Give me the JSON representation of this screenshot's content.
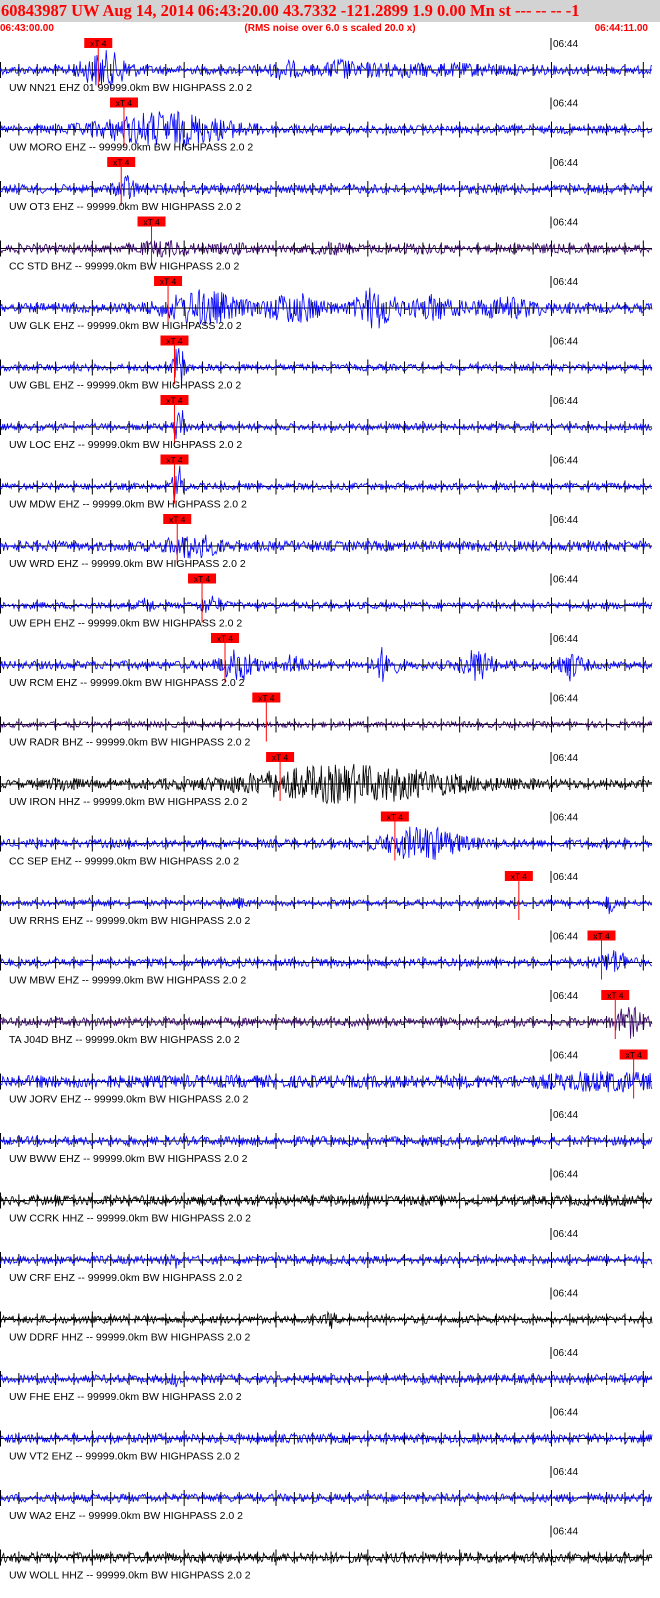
{
  "header": {
    "title": "60843987 UW Aug 14, 2014 06:43:20.00   43.7332 -121.2899  1.9 0.00 Mn st --- -- --  -1",
    "start_time": "06:43:00.00",
    "rms_note": "(RMS noise over 6.0 s scaled 20.0 x)",
    "end_time": "06:44:11.00"
  },
  "colors": {
    "title": "#ff0000",
    "header_bg": "#d3d3d3",
    "pick": "#ff0000",
    "axis": "#000000"
  },
  "chart_data": {
    "type": "line",
    "x_range_seconds": [
      0,
      71
    ],
    "minute_mark_seconds": 60,
    "minute_mark_label": "06:44",
    "pick_label": "xT 4",
    "tick_spacing_seconds": 2,
    "traces": [
      {
        "label": "UW NN21 EHZ 01 99999.0km BW  HIGHPASS  2.0  2",
        "color": "#0000ff",
        "pick_s": 10.7,
        "amp": 0.32,
        "bursts": [
          [
            11.5,
            2.5,
            4.5
          ],
          [
            31,
            1.5,
            2.5
          ],
          [
            37,
            1.2,
            2.5
          ],
          [
            42,
            6,
            1.8
          ],
          [
            52,
            6,
            1.5
          ]
        ]
      },
      {
        "label": "UW MORO EHZ -- 99999.0km BW  HIGHPASS  2.0  2",
        "color": "#0000ff",
        "pick_s": 13.5,
        "amp": 0.3,
        "bursts": [
          [
            18,
            7,
            4.5
          ]
        ]
      },
      {
        "label": "UW OT3 EHZ -- 99999.0km BW  HIGHPASS  2.0  2",
        "color": "#0000ff",
        "pick_s": 13.2,
        "amp": 0.32,
        "bursts": [
          [
            13.8,
            1,
            3.5
          ]
        ]
      },
      {
        "label": "CC STD BHZ -- 99999.0km BW  HIGHPASS  2.0  2",
        "color": "#330066",
        "pick_s": 16.5,
        "amp": 0.3,
        "bursts": [
          [
            18,
            3,
            2.2
          ],
          [
            26,
            2,
            1.6
          ],
          [
            36,
            2,
            1.8
          ],
          [
            45,
            3,
            1.4
          ],
          [
            58,
            3,
            1.3
          ]
        ]
      },
      {
        "label": "UW GLK EHZ -- 99999.0km BW  HIGHPASS  2.0  2",
        "color": "#0000ff",
        "pick_s": 18.3,
        "amp": 0.35,
        "bursts": [
          [
            22,
            4,
            4
          ],
          [
            32,
            3,
            3.5
          ],
          [
            41,
            2,
            5
          ],
          [
            47,
            2,
            3
          ],
          [
            55,
            4,
            2.5
          ]
        ]
      },
      {
        "label": "UW GBL EHZ -- 99999.0km BW  HIGHPASS  2.0  2",
        "color": "#0000ff",
        "pick_s": 19.0,
        "amp": 0.25,
        "bursts": [
          [
            19.5,
            0.6,
            7
          ]
        ]
      },
      {
        "label": "UW LOC EHZ -- 99999.0km BW  HIGHPASS  2.0  2",
        "color": "#0000ff",
        "pick_s": 19.0,
        "amp": 0.25,
        "bursts": [
          [
            19.6,
            0.6,
            7
          ]
        ]
      },
      {
        "label": "UW MDW EHZ -- 99999.0km BW  HIGHPASS  2.0  2",
        "color": "#0000ff",
        "pick_s": 19.0,
        "amp": 0.25,
        "bursts": [
          [
            19.4,
            0.6,
            7
          ]
        ]
      },
      {
        "label": "UW WRD EHZ -- 99999.0km BW  HIGHPASS  2.0  2",
        "color": "#0000ff",
        "pick_s": 19.3,
        "amp": 0.35,
        "bursts": [
          [
            21,
            2.5,
            3
          ]
        ]
      },
      {
        "label": "UW EPH EHZ -- 99999.0km BW  HIGHPASS  2.0  2",
        "color": "#0000ff",
        "pick_s": 22.0,
        "amp": 0.25,
        "bursts": [
          [
            23,
            1.2,
            3
          ],
          [
            16,
            0.8,
            2.5
          ]
        ]
      },
      {
        "label": "UW RCM EHZ -- 99999.0km BW  HIGHPASS  2.0  2",
        "color": "#0000ff",
        "pick_s": 24.5,
        "amp": 0.3,
        "bursts": [
          [
            26,
            2,
            4
          ],
          [
            32,
            1,
            3
          ],
          [
            42,
            1,
            5
          ],
          [
            52,
            1.5,
            4.5
          ],
          [
            62,
            1.2,
            4
          ]
        ]
      },
      {
        "label": "UW RADR BHZ -- 99999.0km BW  HIGHPASS  2.0  2",
        "color": "#330066",
        "pick_s": 29.0,
        "amp": 0.22,
        "bursts": []
      },
      {
        "label": "UW IRON HHZ -- 99999.0km BW  HIGHPASS  2.0  2",
        "color": "#000000",
        "pick_s": 30.5,
        "amp": 0.3,
        "bursts": [
          [
            7,
            1.5,
            2
          ],
          [
            38,
            12,
            4.8
          ]
        ]
      },
      {
        "label": "CC SEP EHZ -- 99999.0km BW  HIGHPASS  2.0  2",
        "color": "#0000ff",
        "pick_s": 43.0,
        "amp": 0.3,
        "bursts": [
          [
            46,
            4,
            4.5
          ]
        ]
      },
      {
        "label": "UW RRHS EHZ -- 99999.0km BW  HIGHPASS  2.0  2",
        "color": "#0000ff",
        "pick_s": 56.5,
        "amp": 0.22,
        "bursts": [
          [
            10,
            1,
            2
          ],
          [
            26,
            1,
            2
          ],
          [
            66.5,
            0.5,
            4
          ]
        ]
      },
      {
        "label": "UW MBW EHZ -- 99999.0km BW  HIGHPASS  2.0  2",
        "color": "#0000ff",
        "pick_s": 65.5,
        "amp": 0.28,
        "bursts": [
          [
            67,
            1.5,
            3.5
          ]
        ]
      },
      {
        "label": "TA J04D BHZ -- 99999.0km BW  HIGHPASS  2.0  2",
        "color": "#330066",
        "pick_s": 67.0,
        "amp": 0.3,
        "bursts": [
          [
            68.5,
            1.5,
            4
          ]
        ]
      },
      {
        "label": "UW JORV EHZ -- 99999.0km BW  HIGHPASS  2.0  2",
        "color": "#0000ff",
        "pick_s": 69.0,
        "amp": 0.45,
        "bursts": [
          [
            66,
            6,
            1.8
          ]
        ]
      },
      {
        "label": "UW BWW EHZ -- 99999.0km BW  HIGHPASS  2.0  2",
        "color": "#0000ff",
        "pick_s": null,
        "amp": 0.32,
        "bursts": []
      },
      {
        "label": "UW CCRK HHZ -- 99999.0km BW  HIGHPASS  2.0  2",
        "color": "#000000",
        "pick_s": null,
        "amp": 0.35,
        "bursts": []
      },
      {
        "label": "UW CRF EHZ -- 99999.0km BW  HIGHPASS  2.0  2",
        "color": "#0000ff",
        "pick_s": null,
        "amp": 0.3,
        "bursts": [
          [
            19,
            0.4,
            2.5
          ]
        ]
      },
      {
        "label": "UW DDRF HHZ -- 99999.0km BW  HIGHPASS  2.0  2",
        "color": "#000000",
        "pick_s": null,
        "amp": 0.28,
        "bursts": [
          [
            36,
            0.5,
            2.5
          ]
        ]
      },
      {
        "label": "UW FHE EHZ -- 99999.0km BW  HIGHPASS  2.0  2",
        "color": "#0000ff",
        "pick_s": null,
        "amp": 0.3,
        "bursts": [
          [
            19,
            0.4,
            2.2
          ]
        ]
      },
      {
        "label": "UW VT2 EHZ -- 99999.0km BW  HIGHPASS  2.0  2",
        "color": "#0000ff",
        "pick_s": null,
        "amp": 0.32,
        "bursts": []
      },
      {
        "label": "UW WA2 EHZ -- 99999.0km BW  HIGHPASS  2.0  2",
        "color": "#0000ff",
        "pick_s": null,
        "amp": 0.3,
        "bursts": []
      },
      {
        "label": "UW WOLL HHZ -- 99999.0km BW  HIGHPASS  2.0  2",
        "color": "#000000",
        "pick_s": null,
        "amp": 0.35,
        "bursts": []
      }
    ]
  }
}
